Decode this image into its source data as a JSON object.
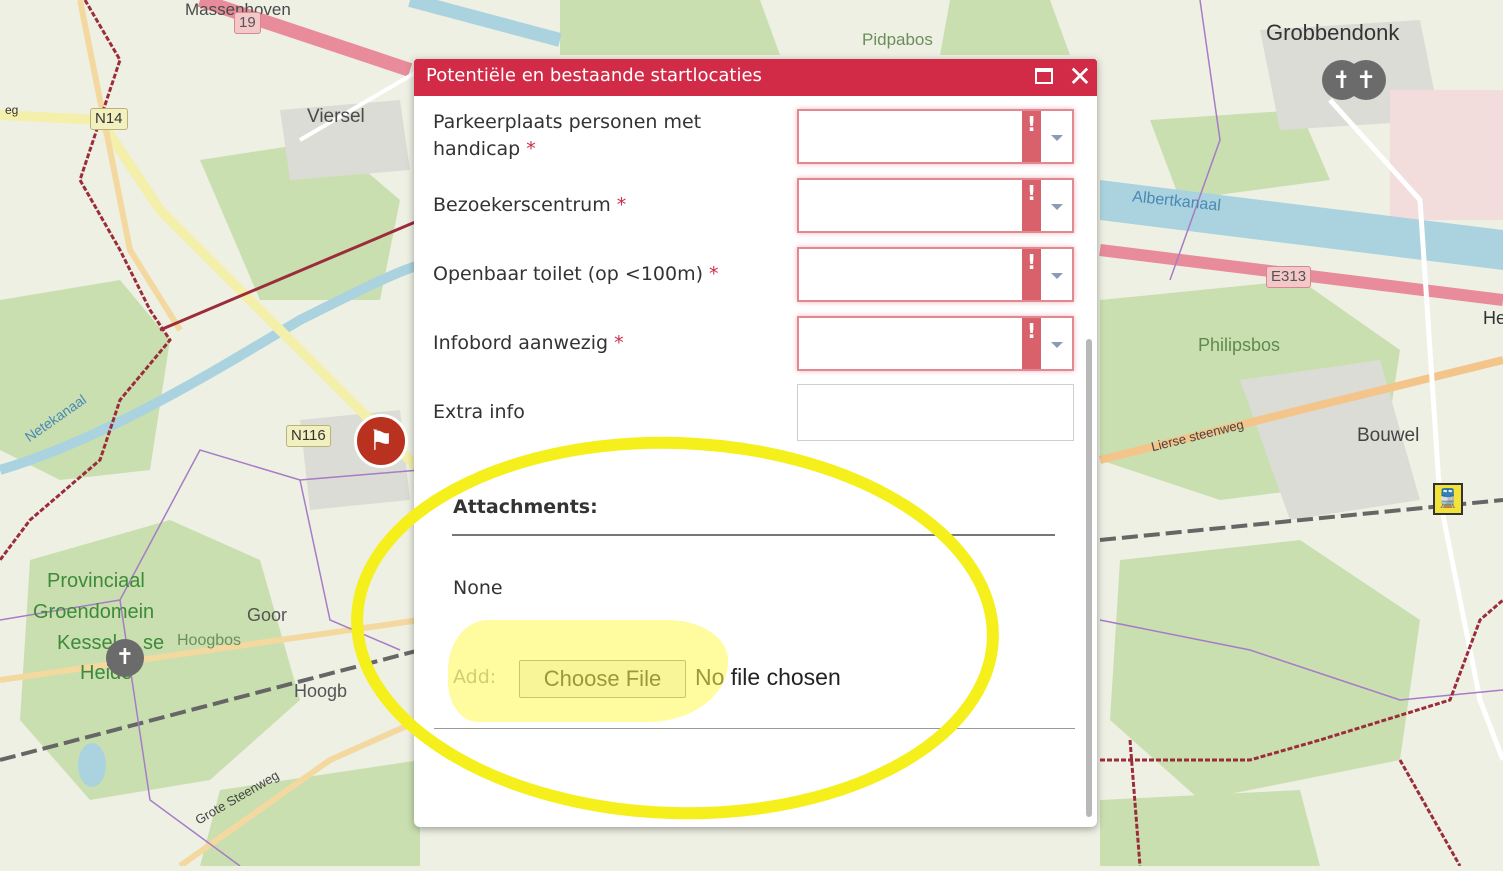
{
  "map": {
    "labels": {
      "massenhoven": "Massenhoven",
      "viersel": "Viersel",
      "pidpabos": "Pidpabos",
      "grobbendonk": "Grobbendonk",
      "albertkanaal": "Albertkanaal",
      "philipsbos": "Philipsbos",
      "bouwel": "Bouwel",
      "lierse_steenweg": "Lierse steenweg",
      "netekanaal": "Netekanaal",
      "provinciaal": "Provinciaal",
      "groendomein": "Groendomein",
      "kessel": "Kessel",
      "se": "se",
      "heide": "Heide",
      "goor": "Goor",
      "hoogbos1": "Hoogbos",
      "hoogbos2": "Hoogb",
      "grote_steenweg": "Grote Steenweg",
      "he": "He",
      "eg": "eg"
    },
    "shields": {
      "n14": "N14",
      "n116": "N116",
      "e313": "E313",
      "r19": "19"
    },
    "colors": {
      "land": "#eef0e4",
      "forest": "#c9dfb0",
      "water": "#aad3df",
      "boundary": "#9b2d3a",
      "admin": "#a67cc6"
    }
  },
  "popup": {
    "title": "Potentiële en bestaande startlocaties",
    "maximize_icon": "maximize-icon",
    "close_icon": "close-icon",
    "close_glyph": "✕",
    "fields": [
      {
        "label": "Parkeerplaats personen met handicap",
        "required": "*"
      },
      {
        "label": "Bezoekerscentrum",
        "required": "*"
      },
      {
        "label": "Openbaar toilet (op <100m)",
        "required": "*"
      },
      {
        "label": "Infobord aanwezig",
        "required": "*"
      }
    ],
    "warn_glyph": "!",
    "extra_info_label": "Extra info",
    "attachments": {
      "title": "Attachments:",
      "none": "None",
      "add_label": "Add:",
      "choose_file": "Choose File",
      "no_file": "No file chosen"
    },
    "accent": "#d12b47"
  }
}
